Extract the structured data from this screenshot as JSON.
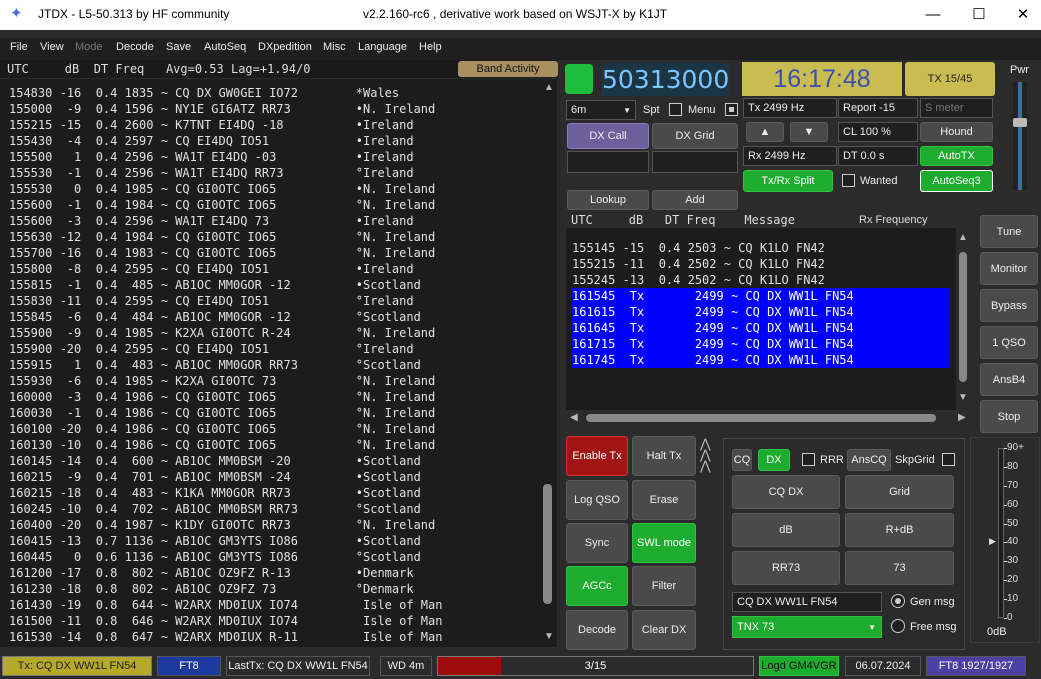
{
  "titlebar": {
    "title": "JTDX - L5-50.313  by HF community",
    "subtitle": "v2.2.160-rc6 , derivative work based on WSJT-X by K1JT",
    "minimize": "—",
    "maximize": "☐",
    "close": "✕"
  },
  "menu": [
    "File",
    "View",
    "Mode",
    "Decode",
    "Save",
    "AutoSeq",
    "DXpedition",
    "Misc",
    "Language",
    "Help"
  ],
  "left": {
    "header": "UTC     dB  DT Freq   Avg=0.53 Lag=+1.94/0",
    "band_activity": "Band Activity",
    "rows": [
      "154830 -16  0.4 1835 ~ CQ DX GW0GEI IO72        *Wales",
      "155000  -9  0.4 1596 ~ NY1E GI6ATZ RR73         •N. Ireland",
      "155215 -15  0.4 2600 ~ K7TNT EI4DQ -18          •Ireland",
      "155430  -4  0.4 2597 ~ CQ EI4DQ IO51            •Ireland",
      "155500   1  0.4 2596 ~ WA1T EI4DQ -03           •Ireland",
      "155530  -1  0.4 2596 ~ WA1T EI4DQ RR73          °Ireland",
      "155530   0  0.4 1985 ~ CQ GI0OTC IO65           •N. Ireland",
      "155600  -1  0.4 1984 ~ CQ GI0OTC IO65           °N. Ireland",
      "155600  -3  0.4 2596 ~ WA1T EI4DQ 73            •Ireland",
      "155630 -12  0.4 1984 ~ CQ GI0OTC IO65           °N. Ireland",
      "155700 -16  0.4 1983 ~ CQ GI0OTC IO65           °N. Ireland",
      "155800  -8  0.4 2595 ~ CQ EI4DQ IO51            •Ireland",
      "155815  -1  0.4  485 ~ AB1OC MM0GOR -12         •Scotland",
      "155830 -11  0.4 2595 ~ CQ EI4DQ IO51            °Ireland",
      "155845  -6  0.4  484 ~ AB1OC MM0GOR -12         °Scotland",
      "155900  -9  0.4 1985 ~ K2XA GI0OTC R-24         °N. Ireland",
      "155900 -20  0.4 2595 ~ CQ EI4DQ IO51            °Ireland",
      "155915   1  0.4  483 ~ AB1OC MM0GOR RR73        °Scotland",
      "155930  -6  0.4 1985 ~ K2XA GI0OTC 73           °N. Ireland",
      "160000  -3  0.4 1986 ~ CQ GI0OTC IO65           °N. Ireland",
      "160030  -1  0.4 1986 ~ CQ GI0OTC IO65           °N. Ireland",
      "160100 -20  0.4 1986 ~ CQ GI0OTC IO65           °N. Ireland",
      "160130 -10  0.4 1986 ~ CQ GI0OTC IO65           °N. Ireland",
      "160145 -14  0.4  600 ~ AB1OC MM0BSM -20         •Scotland",
      "160215  -9  0.4  701 ~ AB1OC MM0BSM -24         •Scotland",
      "160215 -18  0.4  483 ~ K1KA MM0GOR RR73         •Scotland",
      "160245 -10  0.4  702 ~ AB1OC MM0BSM RR73        °Scotland",
      "160400 -20  0.4 1987 ~ K1DY GI0OTC RR73         °N. Ireland",
      "160415 -13  0.7 1136 ~ AB1OC GM3YTS IO86        •Scotland",
      "160445   0  0.6 1136 ~ AB1OC GM3YTS IO86        °Scotland",
      "161200 -17  0.8  802 ~ AB1OC OZ9FZ R-13         •Denmark",
      "161230 -18  0.8  802 ~ AB1OC OZ9FZ 73           °Denmark",
      "161430 -19  0.8  644 ~ W2ARX MD0IUX IO74         Isle of Man",
      "161500 -11  0.8  646 ~ W2ARX MD0IUX IO74         Isle of Man",
      "161530 -14  0.8  647 ~ W2ARX MD0IUX R-11         Isle of Man"
    ]
  },
  "top": {
    "frequency": "50313000",
    "clock": "16:17:48",
    "tx_counter": "TX 15/45",
    "pwr_label": "Pwr"
  },
  "controls": {
    "band": "6m",
    "spt": "Spt",
    "menu": "Menu",
    "dx_call": "DX Call",
    "dx_grid": "DX Grid",
    "lookup": "Lookup",
    "add": "Add",
    "tx_freq": "Tx  2499  Hz",
    "rx_freq": "Rx  2499  Hz",
    "report": "Report -15",
    "smeter": "S meter",
    "cl": "CL  100 %",
    "dt": "DT 0.0 s",
    "hound": "Hound",
    "autotx": "AutoTX",
    "txrx_split": "Tx/Rx Split",
    "wanted": "Wanted",
    "autoseq3": "AutoSeq3",
    "up_arrow": "▲",
    "down_arrow": "▼"
  },
  "rx": {
    "header_cols": "UTC     dB   DT Freq    Message",
    "header_right": "Rx Frequency",
    "rows": [
      {
        "text": "155145 -15  0.4 2503 ~ CQ K1LO FN42",
        "tx": false
      },
      {
        "text": "155215 -11  0.4 2502 ~ CQ K1LO FN42",
        "tx": false
      },
      {
        "text": "155245 -13  0.4 2502 ~ CQ K1LO FN42",
        "tx": false
      },
      {
        "text": "161545  Tx       2499 ~ CQ DX WW1L FN54",
        "tx": true
      },
      {
        "text": "161615  Tx       2499 ~ CQ DX WW1L FN54",
        "tx": true
      },
      {
        "text": "161645  Tx       2499 ~ CQ DX WW1L FN54",
        "tx": true
      },
      {
        "text": "161715  Tx       2499 ~ CQ DX WW1L FN54",
        "tx": true
      },
      {
        "text": "161745  Tx       2499 ~ CQ DX WW1L FN54",
        "tx": true
      }
    ]
  },
  "side": [
    "Tune",
    "Monitor",
    "Bypass",
    "1 QSO",
    "AnsB4",
    "Stop"
  ],
  "actions": {
    "enable_tx": "Enable Tx",
    "halt_tx": "Halt Tx",
    "log_qso": "Log QSO",
    "erase": "Erase",
    "sync": "Sync",
    "swl_mode": "SWL mode",
    "agcc": "AGCc",
    "filter": "Filter",
    "decode": "Decode",
    "clear_dx": "Clear DX"
  },
  "msg": {
    "cq": "CQ",
    "dx": "DX",
    "rrr": "RRR",
    "anscq": "AnsCQ",
    "skpgrid": "SkpGrid",
    "cq_dx": "CQ DX",
    "grid": "Grid",
    "db": "dB",
    "r_db": "R+dB",
    "rr73": "RR73",
    "seventy3": "73",
    "gen_text": "CQ DX WW1L FN54",
    "gen_msg": "Gen msg",
    "free_text": "TNX 73",
    "free_msg": "Free msg"
  },
  "meter": {
    "ticks": [
      "90+",
      "80",
      "70",
      "60",
      "50",
      "40",
      "30",
      "20",
      "10",
      "0"
    ],
    "unit": "0dB",
    "level_db": 40
  },
  "status": {
    "tx": "Tx: CQ DX WW1L FN54",
    "mode": "FT8",
    "lasttx": "LastTx: CQ DX WW1L FN54",
    "wd": "WD 4m",
    "progress": "3/15",
    "progress_fraction": 0.2,
    "logd": "Logd GM4VGR",
    "date": "06.07.2024",
    "counts": "FT8  1927/1927"
  },
  "colors": {
    "tx_row": "#0000ff",
    "green": "#1dac2d",
    "red": "#a31515",
    "clock_bg": "#c9bd52",
    "freq_text": "#7cc6ff"
  }
}
